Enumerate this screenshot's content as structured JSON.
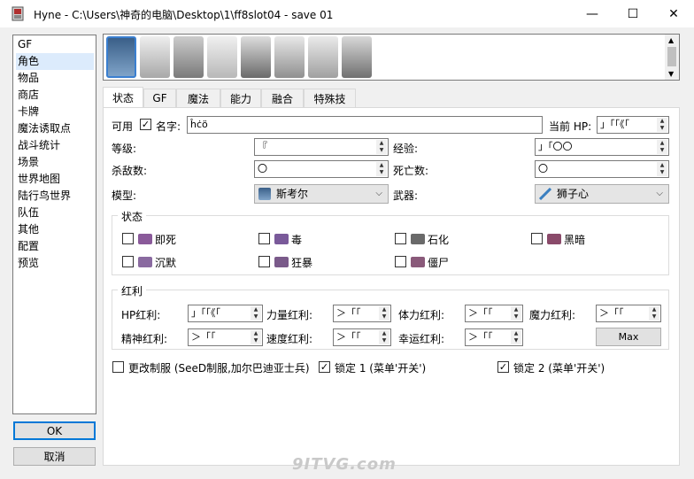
{
  "window": {
    "title": "Hyne - C:\\Users\\神奇的电脑\\Desktop\\1\\ff8slot04 - save 01",
    "minimize": "—",
    "maximize": "☐",
    "close": "✕"
  },
  "sidebar": {
    "items": [
      {
        "label": "GF"
      },
      {
        "label": "角色"
      },
      {
        "label": "物品"
      },
      {
        "label": "商店"
      },
      {
        "label": "卡牌"
      },
      {
        "label": "魔法诱取点"
      },
      {
        "label": "战斗统计"
      },
      {
        "label": "场景"
      },
      {
        "label": "世界地图"
      },
      {
        "label": "陆行鸟世界"
      },
      {
        "label": "队伍"
      },
      {
        "label": "其他"
      },
      {
        "label": "配置"
      },
      {
        "label": "预览"
      }
    ],
    "selected_index": 1
  },
  "buttons": {
    "ok": "OK",
    "cancel": "取消",
    "max": "Max"
  },
  "tabs": [
    "状态",
    "GF",
    "魔法",
    "能力",
    "融合",
    "特殊技"
  ],
  "status_tab": {
    "available_label": "可用",
    "available_checked": true,
    "name_label": "名字:",
    "name_value": "ĥċö",
    "current_hp_label": "当前 HP:",
    "current_hp_value": "」「「《「",
    "level_label": "等级:",
    "level_value": "『",
    "exp_label": "经验:",
    "exp_value": "」「〇〇",
    "kills_label": "杀敌数:",
    "kills_value": "〇",
    "deaths_label": "死亡数:",
    "deaths_value": "〇",
    "model_label": "模型:",
    "model_value": "斯考尔",
    "weapon_label": "武器:",
    "weapon_value": "狮子心",
    "status_group": "状态",
    "statuses": [
      {
        "label": "即死",
        "color": "#8a5a9a"
      },
      {
        "label": "毒",
        "color": "#7a5a9a"
      },
      {
        "label": "石化",
        "color": "#6a6a6a"
      },
      {
        "label": "黑暗",
        "color": "#8a4a6a"
      },
      {
        "label": "沉默",
        "color": "#8a6aa0"
      },
      {
        "label": "狂暴",
        "color": "#7a5a8a"
      },
      {
        "label": "僵尸",
        "color": "#8a5a7a"
      }
    ],
    "bonus_group": "红利",
    "bonuses": {
      "hp_label": "HP红利:",
      "hp_value": "」「「《「",
      "str_label": "力量红利:",
      "str_value": "＞「「",
      "vit_label": "体力红利:",
      "vit_value": "＞「「",
      "mag_label": "魔力红利:",
      "mag_value": "＞「「",
      "spr_label": "精神红利:",
      "spr_value": "＞「「",
      "spd_label": "速度红利:",
      "spd_value": "＞「「",
      "luck_label": "幸运红利:",
      "luck_value": "＞「「"
    },
    "change_uniform_label": "更改制服 (SeeD制服,加尔巴迪亚士兵)",
    "change_uniform_checked": false,
    "lock1_label": "锁定 1 (菜单'开关')",
    "lock1_checked": true,
    "lock2_label": "锁定 2 (菜单'开关')",
    "lock2_checked": true
  },
  "portraits": [
    {
      "name": "squall-portrait",
      "color": "#5a7fa8"
    },
    {
      "name": "zell-portrait",
      "color": "#b8b8b8"
    },
    {
      "name": "irvine-portrait",
      "color": "#9a9a9a"
    },
    {
      "name": "quistis-portrait",
      "color": "#c8c8c8"
    },
    {
      "name": "rinoa-portrait",
      "color": "#8a8a8a"
    },
    {
      "name": "selphie-portrait",
      "color": "#a0a0a0"
    },
    {
      "name": "seifer-portrait",
      "color": "#b0b0b0"
    },
    {
      "name": "edea-portrait",
      "color": "#909090"
    }
  ],
  "watermark": "9ITVG.com"
}
